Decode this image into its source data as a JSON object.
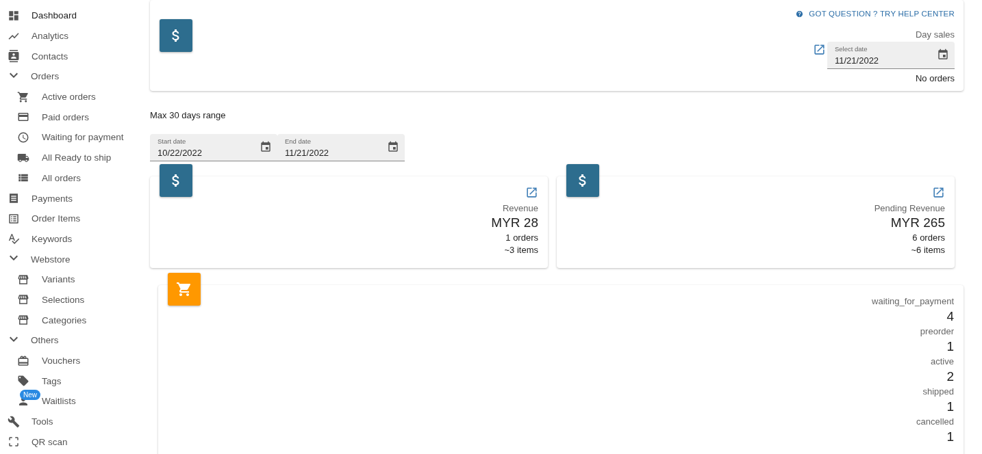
{
  "sidebar": {
    "items": [
      {
        "kind": "item",
        "label": "Dashboard",
        "selected": true
      },
      {
        "kind": "item",
        "label": "Analytics",
        "selected": false
      },
      {
        "kind": "item",
        "label": "Contacts",
        "selected": false
      },
      {
        "kind": "group",
        "label": "Orders",
        "expanded": true,
        "children": [
          {
            "label": "Active orders",
            "selected": false
          },
          {
            "label": "Paid orders",
            "selected": false
          },
          {
            "label": "Waiting for payment",
            "selected": false
          },
          {
            "label": "All Ready to ship",
            "selected": false
          },
          {
            "label": "All orders",
            "selected": false
          }
        ]
      },
      {
        "kind": "item",
        "label": "Payments",
        "selected": false
      },
      {
        "kind": "item",
        "label": "Order Items",
        "selected": false
      },
      {
        "kind": "item",
        "label": "Keywords",
        "selected": false
      },
      {
        "kind": "group",
        "label": "Webstore",
        "expanded": true,
        "children": [
          {
            "label": "Variants",
            "selected": false
          },
          {
            "label": "Selections",
            "selected": false
          },
          {
            "label": "Categories",
            "selected": false
          }
        ]
      },
      {
        "kind": "group",
        "label": "Others",
        "expanded": true,
        "children": [
          {
            "label": "Vouchers",
            "selected": false
          },
          {
            "label": "Tags",
            "selected": false
          },
          {
            "label": "Waitlists",
            "selected": false,
            "badge": "New"
          }
        ]
      },
      {
        "kind": "item",
        "label": "Tools",
        "selected": false
      },
      {
        "kind": "item",
        "label": "QR scan",
        "selected": false
      }
    ]
  },
  "help_link": "GOT QUESTION ? TRY HELP CENTER",
  "day_sales": {
    "title": "Day sales",
    "date_field": {
      "label": "Select date",
      "value": "11/21/2022"
    },
    "summary": "No orders"
  },
  "range": {
    "note": "Max 30 days range",
    "start": {
      "label": "Start date",
      "value": "10/22/2022"
    },
    "end": {
      "label": "End date",
      "value": "11/21/2022"
    }
  },
  "revenue_cards": [
    {
      "title": "Revenue",
      "amount": "MYR 28",
      "orders": "1 orders",
      "items": "~3 items"
    },
    {
      "title": "Pending Revenue",
      "amount": "MYR 265",
      "orders": "6 orders",
      "items": "~6 items"
    }
  ],
  "status_counts": [
    {
      "label": "waiting_for_payment",
      "count": "4"
    },
    {
      "label": "preorder",
      "count": "1"
    },
    {
      "label": "active",
      "count": "2"
    },
    {
      "label": "shipped",
      "count": "1"
    },
    {
      "label": "cancelled",
      "count": "1"
    }
  ]
}
